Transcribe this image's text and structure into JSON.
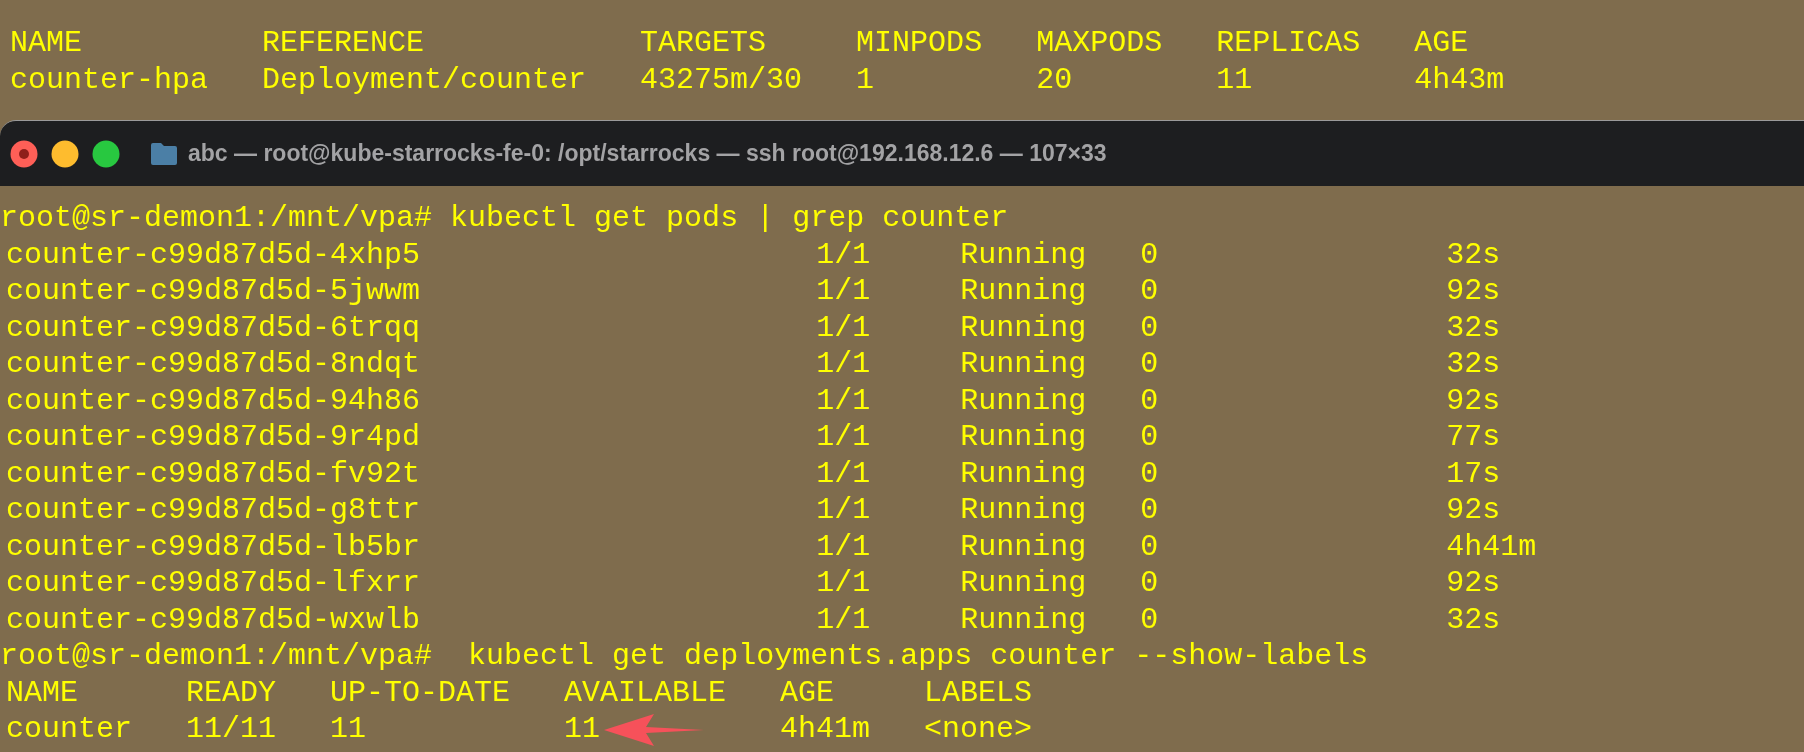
{
  "top_output": {
    "columns": [
      "NAME",
      "REFERENCE",
      "TARGETS",
      "MINPODS",
      "MAXPODS",
      "REPLICAS",
      "AGE"
    ],
    "rows": [
      [
        "counter-hpa",
        "Deployment/counter",
        "43275m/30",
        "1",
        "20",
        "11",
        "4h43m"
      ]
    ]
  },
  "window": {
    "title": "abc — root@kube-starrocks-fe-0: /opt/starrocks — ssh root@192.168.12.6 — 107×33"
  },
  "terminal": [
    {
      "kind": "command",
      "prompt": "root@sr-demon1:/mnt/vpa#",
      "command": " kubectl get pods | grep counter"
    },
    {
      "kind": "pod_list",
      "rows": [
        [
          "counter-c99d87d5d-4xhp5",
          "1/1",
          "Running",
          "0",
          "32s"
        ],
        [
          "counter-c99d87d5d-5jwwm",
          "1/1",
          "Running",
          "0",
          "92s"
        ],
        [
          "counter-c99d87d5d-6trqq",
          "1/1",
          "Running",
          "0",
          "32s"
        ],
        [
          "counter-c99d87d5d-8ndqt",
          "1/1",
          "Running",
          "0",
          "32s"
        ],
        [
          "counter-c99d87d5d-94h86",
          "1/1",
          "Running",
          "0",
          "92s"
        ],
        [
          "counter-c99d87d5d-9r4pd",
          "1/1",
          "Running",
          "0",
          "77s"
        ],
        [
          "counter-c99d87d5d-fv92t",
          "1/1",
          "Running",
          "0",
          "17s"
        ],
        [
          "counter-c99d87d5d-g8ttr",
          "1/1",
          "Running",
          "0",
          "92s"
        ],
        [
          "counter-c99d87d5d-lb5br",
          "1/1",
          "Running",
          "0",
          "4h41m"
        ],
        [
          "counter-c99d87d5d-lfxrr",
          "1/1",
          "Running",
          "0",
          "92s"
        ],
        [
          "counter-c99d87d5d-wxwlb",
          "1/1",
          "Running",
          "0",
          "32s"
        ]
      ]
    },
    {
      "kind": "command",
      "prompt": "root@sr-demon1:/mnt/vpa#",
      "command": "  kubectl get deployments.apps counter --show-labels"
    },
    {
      "kind": "table",
      "columns": [
        "NAME",
        "READY",
        "UP-TO-DATE",
        "AVAILABLE",
        "AGE",
        "LABELS"
      ],
      "rows": [
        [
          "counter",
          "11/11",
          "11",
          "11",
          "4h41m",
          "<none>"
        ]
      ]
    }
  ]
}
